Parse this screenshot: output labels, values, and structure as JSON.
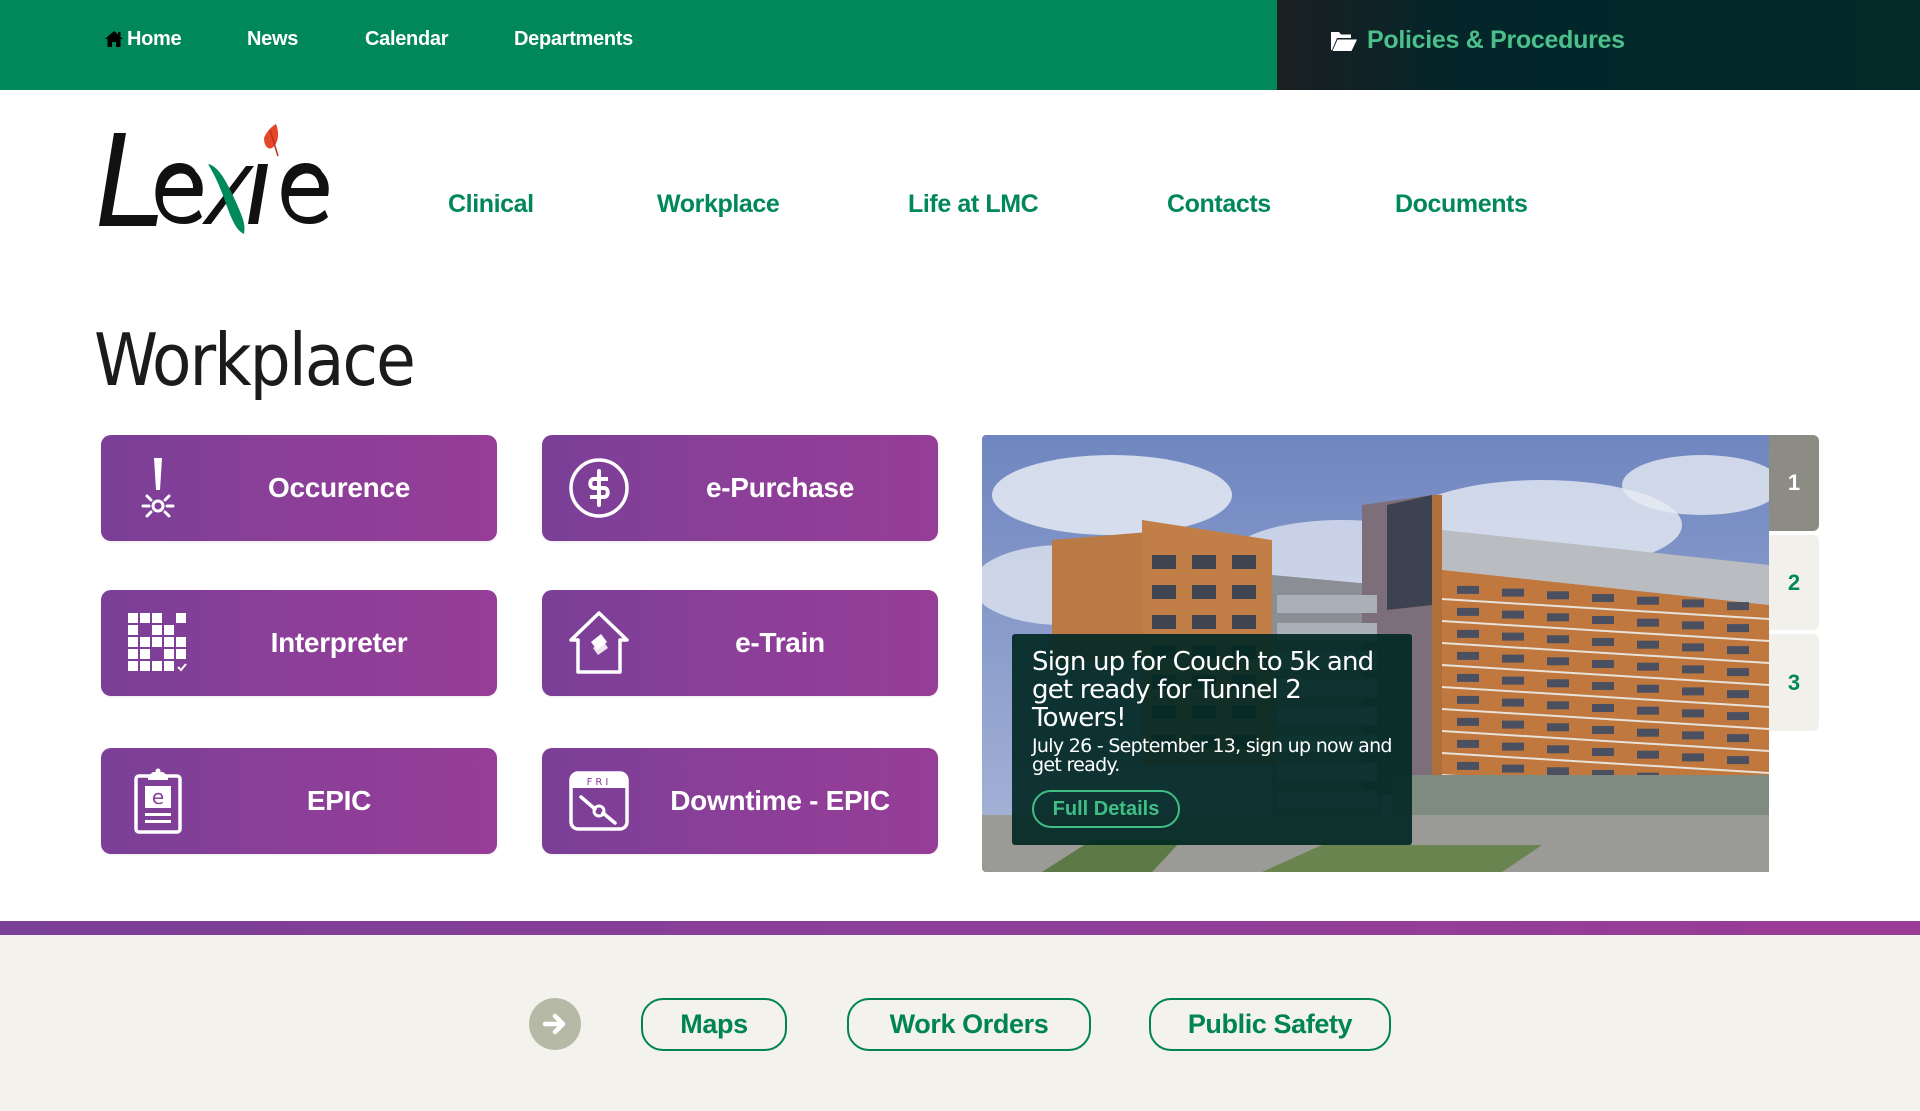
{
  "topbar": {
    "nav": [
      {
        "label": "Home",
        "icon": "home-icon"
      },
      {
        "label": "News"
      },
      {
        "label": "Calendar"
      },
      {
        "label": "Departments"
      }
    ],
    "policies": {
      "label": "Policies & Procedures",
      "icon": "folder-open-icon"
    }
  },
  "brand": {
    "logo_text": "Lexie",
    "colors": {
      "green": "#00875a",
      "purple": "#8a3f98",
      "leaf": "#e4472a"
    }
  },
  "mainnav": {
    "items": [
      {
        "label": "Clinical"
      },
      {
        "label": "Workplace"
      },
      {
        "label": "Life at LMC"
      },
      {
        "label": "Contacts"
      },
      {
        "label": "Documents"
      }
    ]
  },
  "page": {
    "title": "Workplace"
  },
  "tiles": [
    {
      "label": "Occurence",
      "icon": "alert-icon"
    },
    {
      "label": "e-Purchase",
      "icon": "dollar-circle-icon"
    },
    {
      "label": "Interpreter",
      "icon": "grid-check-icon"
    },
    {
      "label": "e-Train",
      "icon": "house-book-icon"
    },
    {
      "label": "EPIC",
      "icon": "clipboard-e-icon"
    },
    {
      "label": "Downtime - EPIC",
      "icon": "calendar-downtime-icon",
      "icon_text": "FRI"
    }
  ],
  "slider": {
    "active_slide": 1,
    "slide": {
      "title": "Sign up for Couch to 5k and get ready for Tunnel 2 Towers!",
      "body": "July 26 - September 13, sign up now and get ready.",
      "button": "Full Details",
      "image": "hospital-building-photo"
    },
    "tabs": [
      {
        "label": "1"
      },
      {
        "label": "2"
      },
      {
        "label": "3"
      }
    ]
  },
  "footer": {
    "arrow_icon": "arrow-right-icon",
    "links": [
      {
        "label": "Maps"
      },
      {
        "label": "Work Orders"
      },
      {
        "label": "Public Safety"
      }
    ]
  }
}
